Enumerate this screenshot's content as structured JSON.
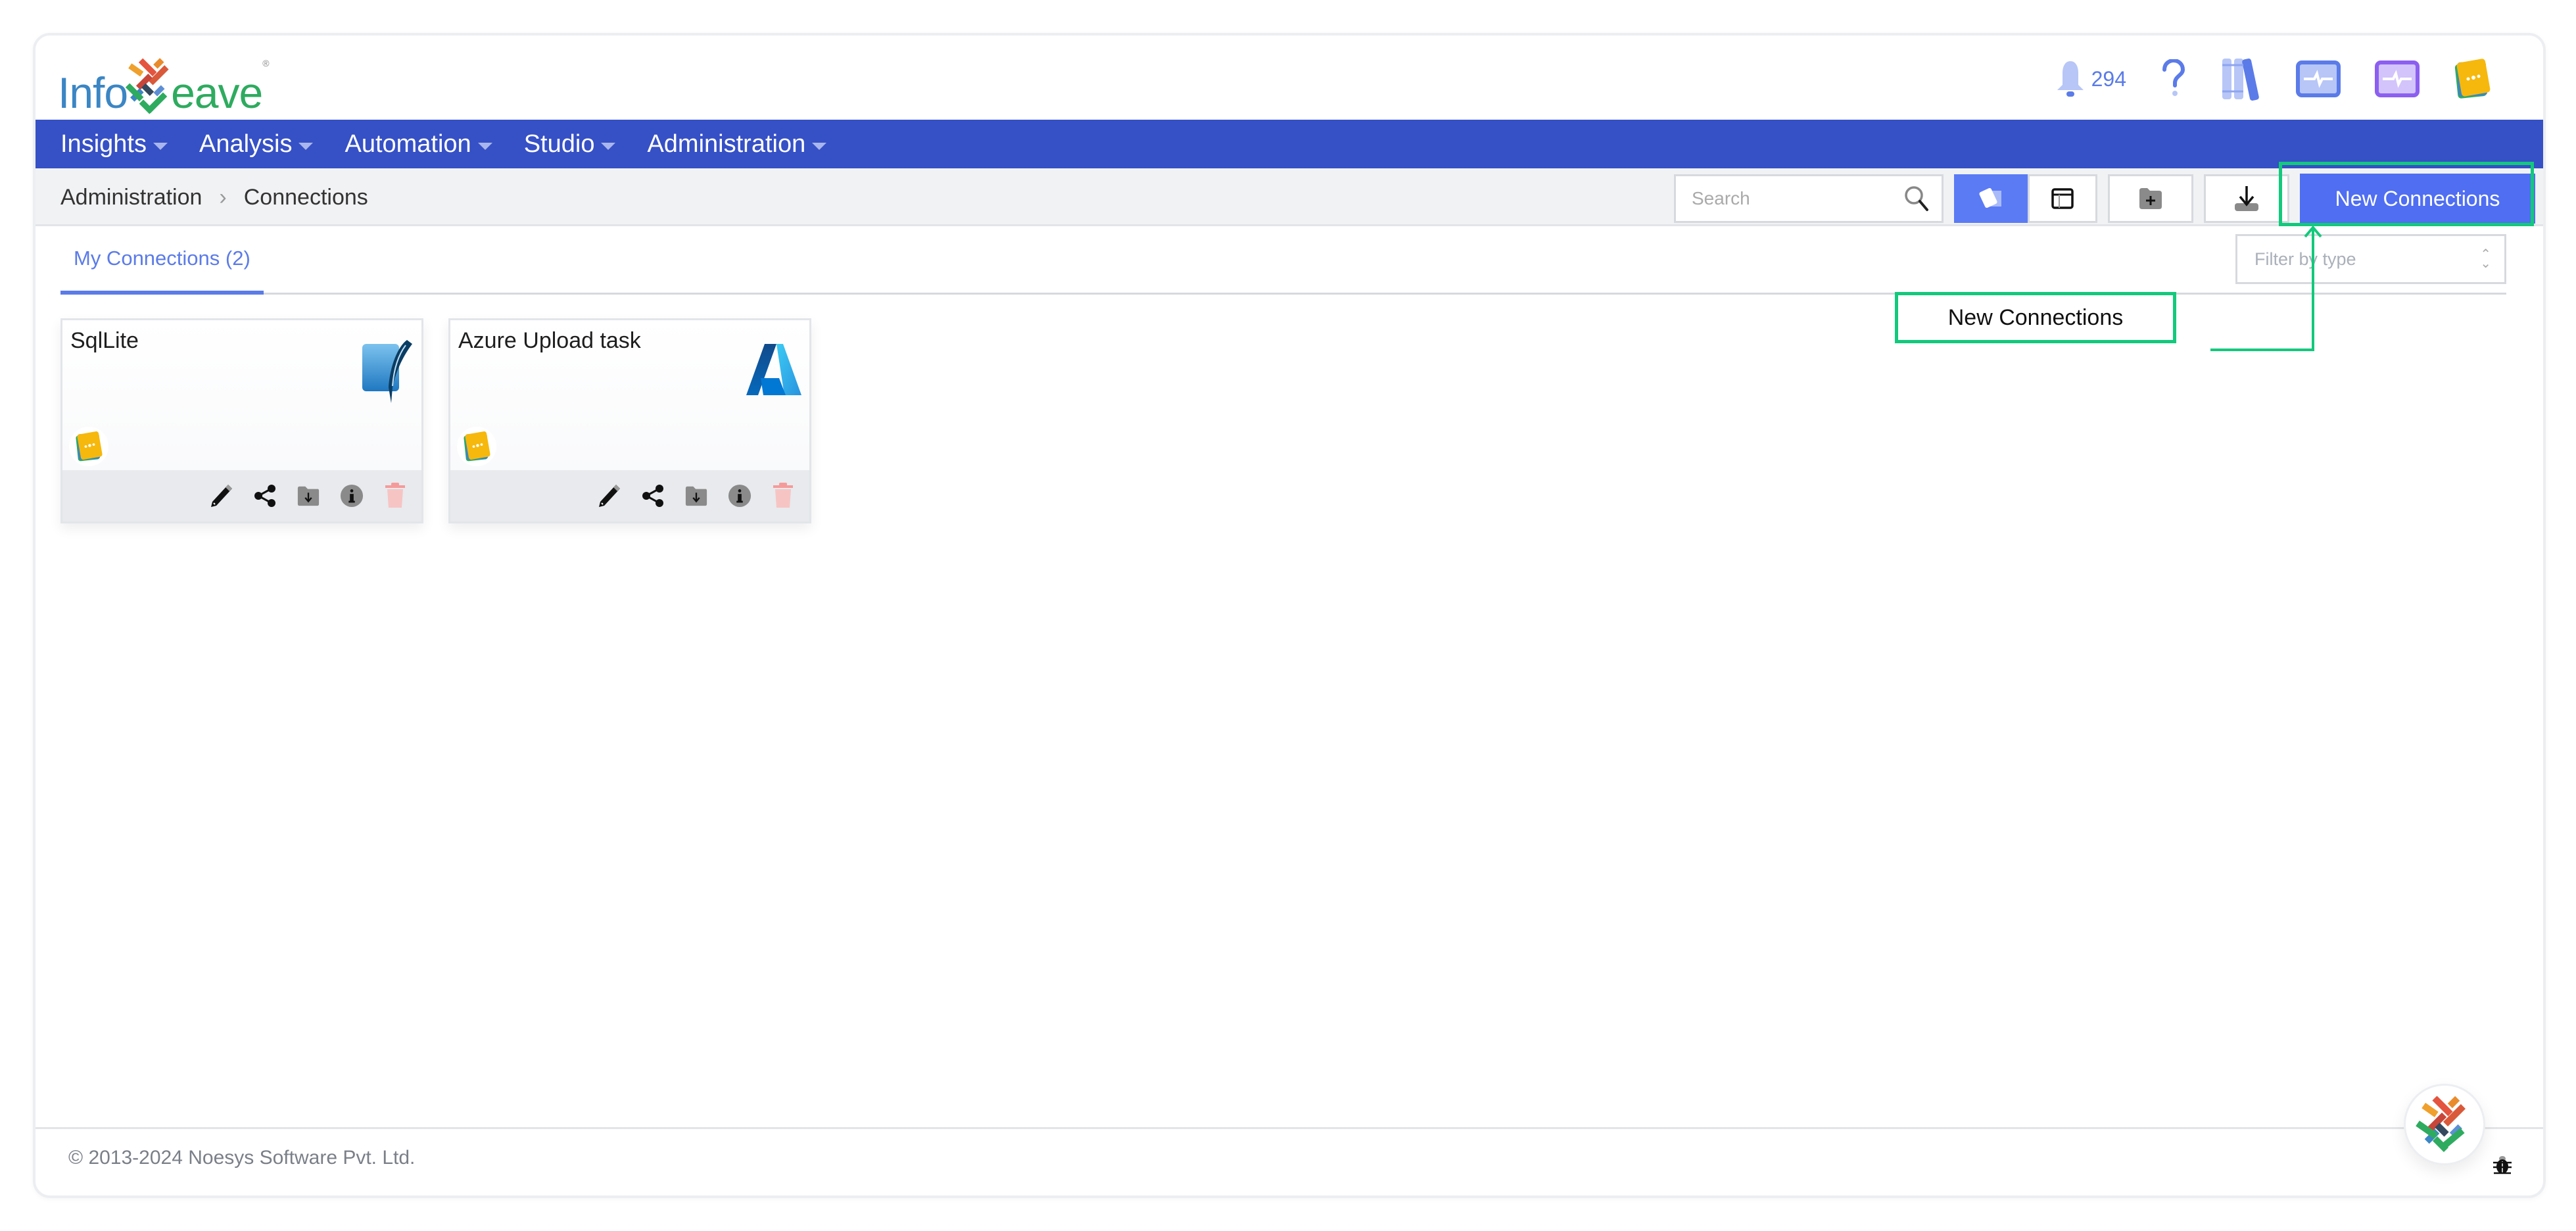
{
  "app": {
    "brand_left": "Info",
    "brand_right": "eave",
    "brand_mark": "®"
  },
  "header": {
    "notifications_count": "294",
    "icons": [
      "bell-icon",
      "help-icon",
      "library-icon",
      "monitor-activity-icon",
      "monitor-activity-purple-icon",
      "user-avatar-icon"
    ]
  },
  "nav": {
    "items": [
      {
        "label": "Insights"
      },
      {
        "label": "Analysis"
      },
      {
        "label": "Automation"
      },
      {
        "label": "Studio"
      },
      {
        "label": "Administration"
      }
    ]
  },
  "breadcrumb": {
    "items": [
      "Administration",
      "Connections"
    ],
    "separator": "›"
  },
  "toolbar": {
    "search_placeholder": "Search",
    "view_modes": [
      "card-view",
      "table-view"
    ],
    "active_view": "card-view",
    "new_button_label": "New Connections"
  },
  "tabs": {
    "active_label": "My Connections (2)",
    "filter_placeholder": "Filter by type"
  },
  "connections": [
    {
      "name": "SqlLite",
      "type_icon": "sqlite-logo-icon"
    },
    {
      "name": "Azure Upload task",
      "type_icon": "azure-logo-icon"
    }
  ],
  "card_actions": [
    "edit-icon",
    "share-icon",
    "download-folder-icon",
    "info-icon",
    "delete-icon"
  ],
  "annotation": {
    "label": "New Connections",
    "color": "#12c97c"
  },
  "footer": {
    "copyright": "© 2013-2024 Noesys Software Pvt. Ltd."
  },
  "colors": {
    "nav_bg": "#3650c6",
    "primary": "#4f6ef2",
    "tab_active": "#5b7be8",
    "annotation": "#12c97c"
  }
}
